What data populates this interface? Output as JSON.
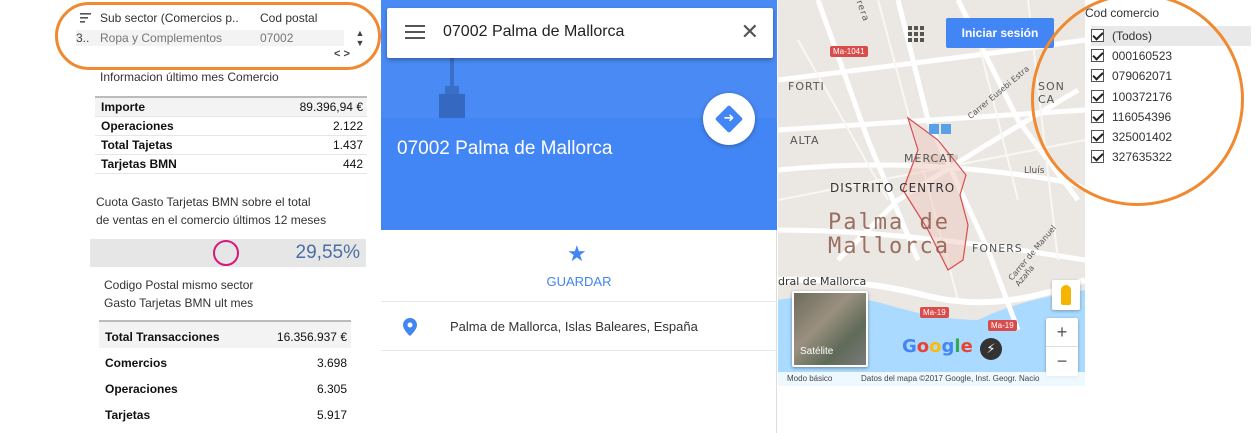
{
  "filter_table": {
    "col1_header": "Sub sector (Comercios p..",
    "col2_header": "Cod postal",
    "row_index": "3..",
    "row_col1": "Ropa y Complementos",
    "row_col2": "07002",
    "scroll_up_icon": "chevron-up",
    "scroll_down_icon": "chevron-down",
    "scroll_lr_icon": "chevrons-left-right"
  },
  "info": {
    "title": "Informacion último mes Comercio",
    "rows": [
      {
        "label": "Importe",
        "value": "89.396,94 €"
      },
      {
        "label": "Operaciones",
        "value": "2.122"
      },
      {
        "label": "Total Tajetas",
        "value": "1.437"
      },
      {
        "label": "Tarjetas BMN",
        "value": "442"
      }
    ]
  },
  "quota": {
    "line1": "Cuota Gasto Tarjetas BMN  sobre el total",
    "line2": "de ventas en el comercio últimos 12 meses",
    "value": "29,55%",
    "circle_color": "#d6197c"
  },
  "postal": {
    "line1": "Codigo Postal mismo sector",
    "line2": "Gasto Tarjetas BMN ult mes",
    "rows": [
      {
        "label": "Total Transacciones",
        "value": "16.356.937 €"
      },
      {
        "label": "Comercios",
        "value": "3.698"
      },
      {
        "label": "Operaciones",
        "value": "6.305"
      },
      {
        "label": "Tarjetas",
        "value": "5.917"
      }
    ]
  },
  "gmaps": {
    "search_query": "07002 Palma de Mallorca",
    "place_title": "07002 Palma de Mallorca",
    "save_label": "GUARDAR",
    "address": "Palma de Mallorca, Islas Baleares, España",
    "accent_color": "#4285f4"
  },
  "map": {
    "signin_label": "Iniciar sesión",
    "satellite_label": "Satélite",
    "google_logo": "Google",
    "footer_basic": "Modo básico",
    "footer_data": "Datos del mapa ©2017 Google, Inst. Geogr. Nacio",
    "labels": {
      "forti": "FORTI",
      "alta": "ALTA",
      "mercat": "MERCAT",
      "distrito": "DISTRITO CENTRO",
      "palma": "Palma de",
      "mallorca": "Mallorca",
      "foners": "FONERS",
      "son_ca": "SON CA",
      "catedral": "dral de Mallorca",
      "carrer_eusebi": "Carrer Eusebi Estra",
      "carrer_manuel": "Carrer de Manuel Azaña",
      "lluis": "Lluís",
      "pedrera": "edrera",
      "ma1041": "Ma-1041",
      "ma19a": "Ma-19",
      "ma19b": "Ma-19"
    },
    "zoom_in": "+",
    "zoom_out": "−"
  },
  "cod_comercio": {
    "title": "Cod comercio",
    "items": [
      "(Todos)",
      "000160523",
      "079062071",
      "100372176",
      "116054396",
      "325001402",
      "327635322"
    ]
  },
  "highlight_color": "#f0892f"
}
